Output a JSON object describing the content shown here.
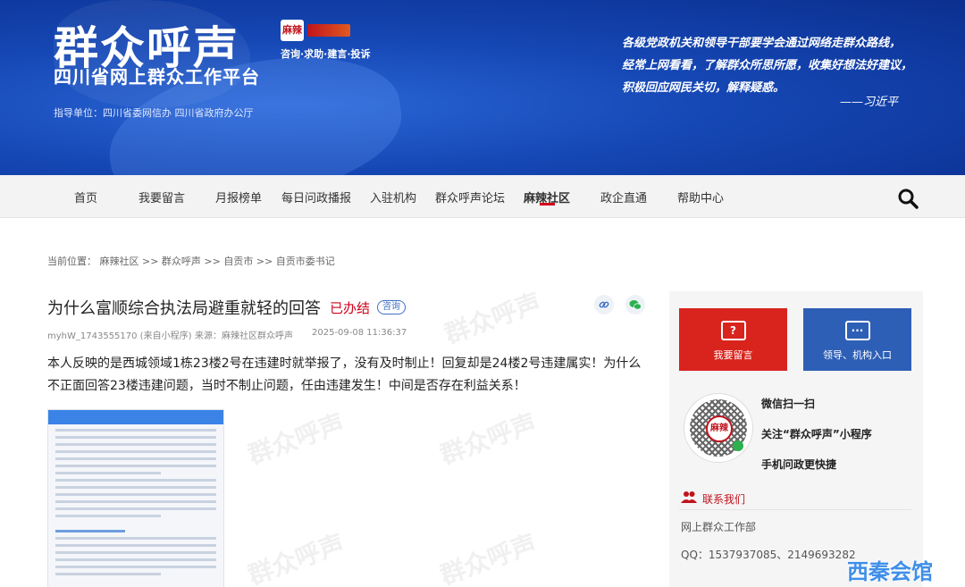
{
  "banner": {
    "title": "群众呼声",
    "subtitle": "四川省网上群众工作平台",
    "logo_text": "麻辣",
    "tags": "咨询·求助·建言·投诉",
    "guide": "指导单位：四川省委网信办  四川省政府办公厅",
    "quote_lines": [
      "各级党政机关和领导干部要学会通过网络走群众路线，",
      "经常上网看看，了解群众所思所愿，收集好想法好建议，",
      "积极回应网民关切，解释疑惑。"
    ],
    "quote_author": "——习近平"
  },
  "nav": {
    "items": [
      "首页",
      "我要留言",
      "月报榜单",
      "每日问政播报",
      "入驻机构",
      "群众呼声论坛",
      "麻辣社区",
      "政企直通",
      "帮助中心"
    ],
    "active": "麻辣社区"
  },
  "breadcrumb": "当前位置：  麻辣社区 >> 群众呼声 >> 自贡市 >> 自贡市委书记",
  "article": {
    "title": "为什么富顺综合执法局避重就轻的回答",
    "status": "已办结",
    "badge": "咨询",
    "meta": {
      "user": "myhW_1743555170 (来自小程序)",
      "source": "来源：麻辣社区群众呼声",
      "time": "2025-09-08 11:36:37"
    },
    "body": "本人反映的是西城领域1栋23楼2号在违建时就举报了，没有及时制止！回复却是24楼2号违建属实！为什么不正面回答23楼违建问题，当时不制止问题，任由违建发生！中间是否存在利益关系！"
  },
  "watermark": "群众呼声",
  "sidebar": {
    "btn_message": "我要留言",
    "btn_entry": "领导、机构入口",
    "qr_center": "麻辣",
    "scan_lines": [
      "微信扫一扫",
      "关注“群众呼声”小程序",
      "手机问政更快捷"
    ],
    "contact_title": "联系我们",
    "org": "网上群众工作部",
    "qq": "QQ：1537937085、2149693282"
  },
  "corner_logo": "西秦会馆",
  "colors": {
    "brand_blue": "#1547b4",
    "accent_red": "#d0021b",
    "entry_blue": "#2e5fb6"
  }
}
